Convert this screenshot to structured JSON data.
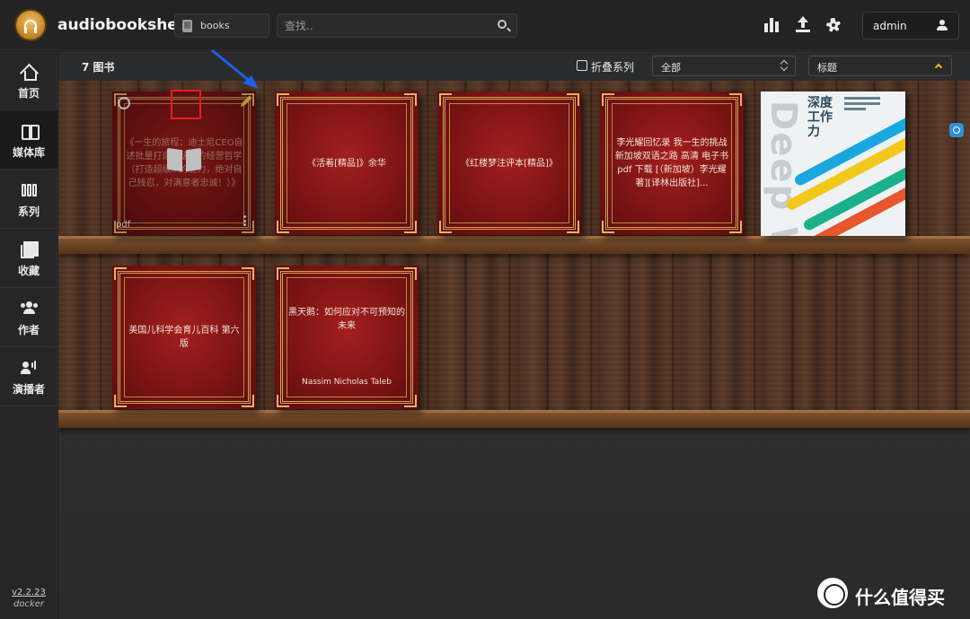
{
  "app": {
    "title": "audiobookshelf"
  },
  "header": {
    "library_name": "books",
    "search_placeholder": "查找..",
    "username": "admin"
  },
  "sidebar": {
    "items": [
      {
        "label": "首页",
        "icon": "home-icon"
      },
      {
        "label": "媒体库",
        "icon": "library-icon",
        "active": true
      },
      {
        "label": "系列",
        "icon": "series-icon"
      },
      {
        "label": "收藏",
        "icon": "collections-icon"
      },
      {
        "label": "作者",
        "icon": "authors-icon"
      },
      {
        "label": "演播者",
        "icon": "narrators-icon"
      }
    ],
    "version": "v2.2.23",
    "install": "docker"
  },
  "toolbar": {
    "count_label": "7 图书",
    "collapse_series_label": "折叠系列",
    "filter_value": "全部",
    "sort_value": "标题"
  },
  "books": [
    {
      "title": "《一生的旅程：迪士尼CEO自述批量打造超级IP的经营哲学（打造超级IP的能力，绝对自己残忍，对满意者忠诚！）》",
      "format": "pdf"
    },
    {
      "title": "《活着[精品]》余华"
    },
    {
      "title": "《红楼梦注评本[精品]》"
    },
    {
      "title": "李光耀回忆录 我一生的挑战 新加坡双语之路 高清 电子书 pdf 下载 [（新加坡）李光耀著][译林出版社]..."
    },
    {
      "title": "深度工作力",
      "cover_text": "Deep Work"
    },
    {
      "title": "美国儿科学会育儿百科 第六版"
    },
    {
      "title": "黑天鹅：如何应对不可预知的未来",
      "author": "Nassim Nicholas Taleb"
    }
  ],
  "watermark": {
    "text": "什么值得买"
  },
  "colors": {
    "accent": "#f0b429",
    "highlight_box": "#e61e1e",
    "annotation_arrow": "#1e5fe6"
  }
}
